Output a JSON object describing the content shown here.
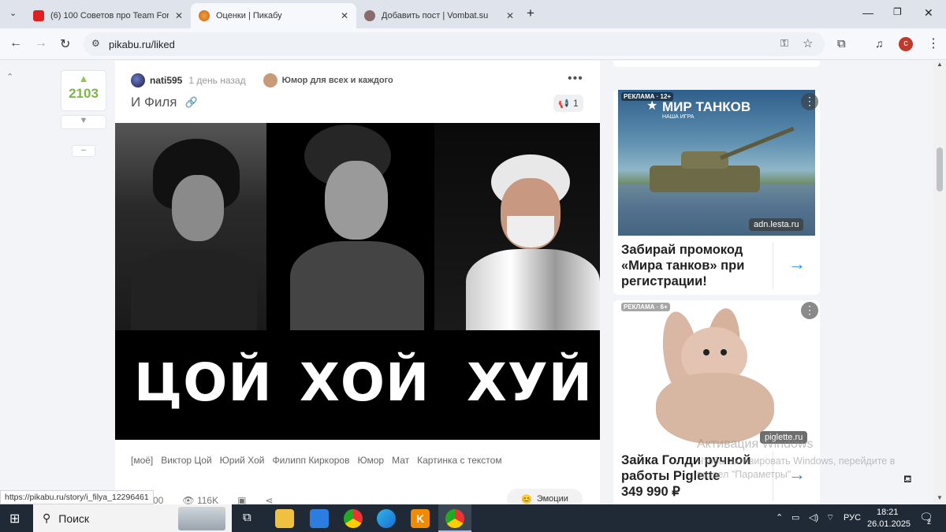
{
  "browser": {
    "tabs": [
      {
        "title": "(6) 100 Советов про Team Fort",
        "active": false
      },
      {
        "title": "Оценки | Пикабу",
        "active": true
      },
      {
        "title": "Добавить пост | Vombat.su",
        "active": false
      }
    ],
    "new_tab": "+",
    "url": "pikabu.ru/liked",
    "profile_initial": "с"
  },
  "post": {
    "rating": "2103",
    "collapse": "–",
    "author": "nati595",
    "time": "1 день назад",
    "community": "Юмор для всех и каждого",
    "title": "И Филя",
    "saves": "1",
    "captions": [
      "ЦОЙ",
      "ХОЙ",
      "ХУЙ"
    ],
    "tags": [
      "[моё]",
      "Виктор Цой",
      "Юрий Хой",
      "Филипп Киркоров",
      "Юмор",
      "Мат",
      "Картинка с текстом"
    ],
    "comments": "00",
    "views": "116K",
    "emotions": "Эмоции"
  },
  "ads": [
    {
      "label": "РЕКЛАМА · 12+",
      "brand": "МИР ТАНКОВ",
      "brand_sub": "НАША ИГРА",
      "source": "adn.lesta.ru",
      "text": "Забирай промокод «Мира танков» при регистрации!"
    },
    {
      "label": "РЕКЛАМА · 6+",
      "source": "piglette.ru",
      "text": "Зайка Голди ручной работы Piglette",
      "price": "349 990 ₽"
    }
  ],
  "watermark": {
    "line1": "Активация Windows",
    "line2": "Чтобы активировать Windows, перейдите в раздел \"Параметры\"."
  },
  "status_url": "https://pikabu.ru/story/i_filya_12296461",
  "taskbar": {
    "search": "Поиск",
    "lang": "РУС",
    "time": "18:21",
    "date": "26.01.2025",
    "notifications": "2"
  }
}
